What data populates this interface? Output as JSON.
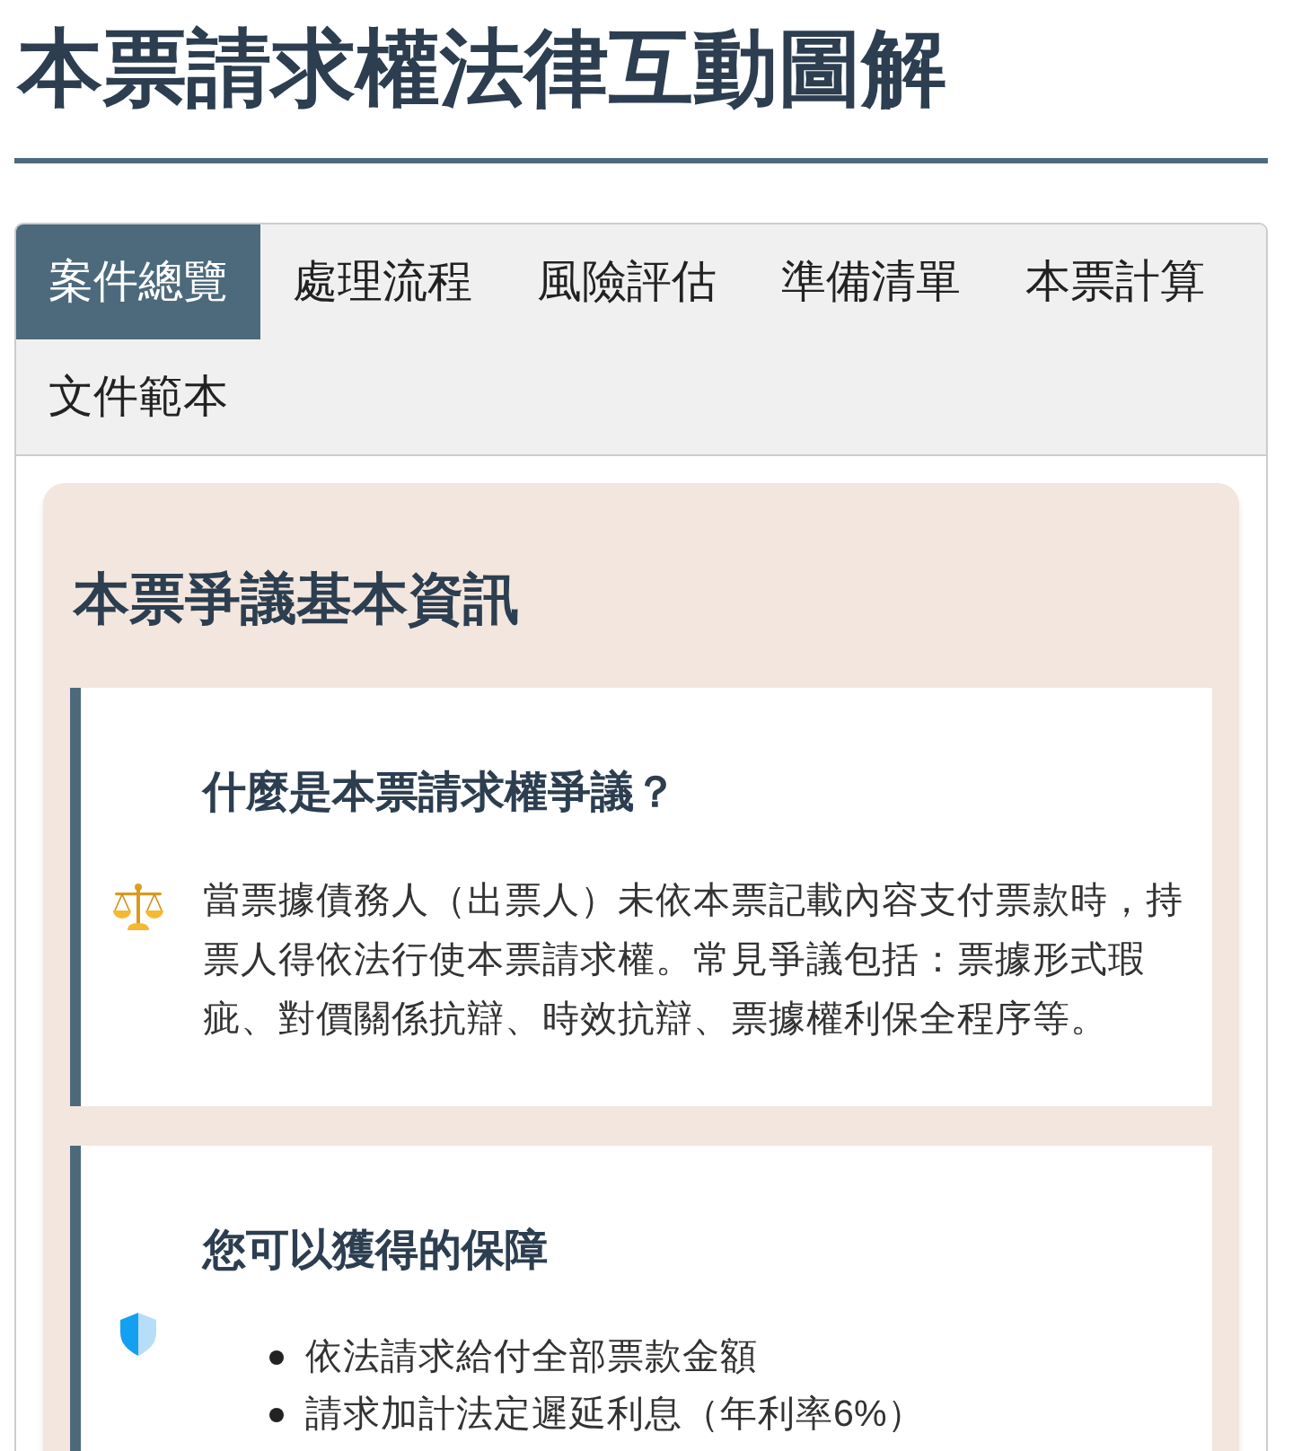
{
  "page": {
    "title": "本票請求權法律互動圖解"
  },
  "tabs": [
    {
      "label": "案件總覽",
      "selected": true
    },
    {
      "label": "處理流程",
      "selected": false
    },
    {
      "label": "風險評估",
      "selected": false
    },
    {
      "label": "準備清單",
      "selected": false
    },
    {
      "label": "本票計算",
      "selected": false
    },
    {
      "label": "文件範本",
      "selected": false
    }
  ],
  "section": {
    "title": "本票爭議基本資訊",
    "boxes": [
      {
        "kind": "paragraph",
        "title": "什麼是本票請求權爭議？",
        "text": "當票據債務人（出票人）未依本票記載內容支付票款時，持票人得依法行使本票請求權。常見爭議包括：票據形式瑕疵、對價關係抗辯、時效抗辯、票據權利保全程序等。"
      },
      {
        "kind": "list",
        "title": "您可以獲得的保障",
        "items": [
          "依法請求給付全部票款金額",
          "請求加計法定遲延利息（年利率6%）"
        ]
      }
    ]
  }
}
